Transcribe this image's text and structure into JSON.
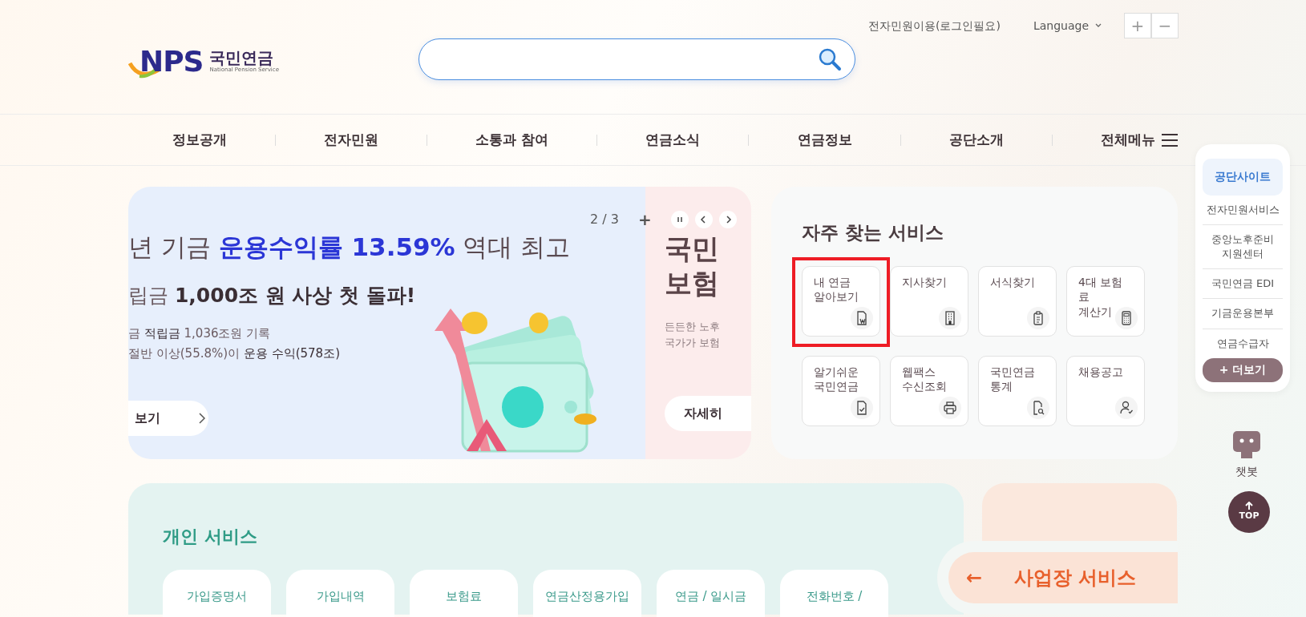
{
  "header": {
    "logo": {
      "mark": "NPS",
      "name": "국민연금",
      "subtitle": "National Pension Service"
    },
    "links": [
      {
        "label": "전자민원이용(로그인필요)",
        "kind": "link"
      },
      {
        "label": "Language",
        "kind": "dropdown"
      }
    ],
    "font_buttons": [
      "+",
      "−"
    ]
  },
  "nav": {
    "items": [
      "정보공개",
      "전자민원",
      "소통과 참여",
      "연금소식",
      "연금정보",
      "공단소개"
    ],
    "all_menu": "전체메뉴"
  },
  "banner": {
    "counter": "2 / 3",
    "add": "+",
    "slides": [
      {
        "lines": [
          "년 기금 **운용수익률 13.59%** 역대 최고",
          "립금 **1,000조 원 사상 첫 돌파!**",
          "금 **적립금** 1,036조원 기록",
          "절반 이상(55.8%)이 **운용 수익(578조)**"
        ],
        "button": "보기"
      },
      {
        "lines": [
          "국민",
          "보험"
        ],
        "desc": [
          "든든한 노후",
          "국가가 보험"
        ],
        "button": "자세히"
      }
    ]
  },
  "frequent_services": {
    "title": "자주 찾는 서비스",
    "items": [
      {
        "label": "내 연금\n알아보기",
        "kind": "doc-w",
        "highlighted": true
      },
      {
        "label": "지사찾기",
        "kind": "building",
        "highlighted": false
      },
      {
        "label": "서식찾기",
        "kind": "clipboard",
        "highlighted": false
      },
      {
        "label": "4대 보험료\n계산기",
        "kind": "calculator",
        "highlighted": false
      },
      {
        "label": "알기쉬운\n국민연금",
        "kind": "doc-check",
        "highlighted": false
      },
      {
        "label": "웹팩스\n수신조회",
        "kind": "printer",
        "highlighted": false
      },
      {
        "label": "국민연금\n통계",
        "kind": "doc-search",
        "highlighted": false
      },
      {
        "label": "채용공고",
        "kind": "person-check",
        "highlighted": false
      }
    ]
  },
  "side_menu": {
    "items": [
      {
        "label": "공단사이트",
        "selected": true
      },
      {
        "label": "전자민원서비스",
        "selected": false
      },
      {
        "label": "중앙노후준비\n지원센터",
        "selected": false
      },
      {
        "label": "국민연금 EDI",
        "selected": false
      },
      {
        "label": "기금운용본부",
        "selected": false
      },
      {
        "label": "연금수급자",
        "selected": false
      }
    ],
    "more": "+ 더보기"
  },
  "chatbot": "챗봇",
  "top_button": "TOP",
  "personal_services": {
    "title": "개인 서비스",
    "items": [
      "가입증명서",
      "가입내역",
      "보험료",
      "연금산정용가입",
      "연금 / 일시금",
      "전화번호 /"
    ]
  },
  "business_services": {
    "arrow": "←",
    "label": "사업장 서비스"
  }
}
